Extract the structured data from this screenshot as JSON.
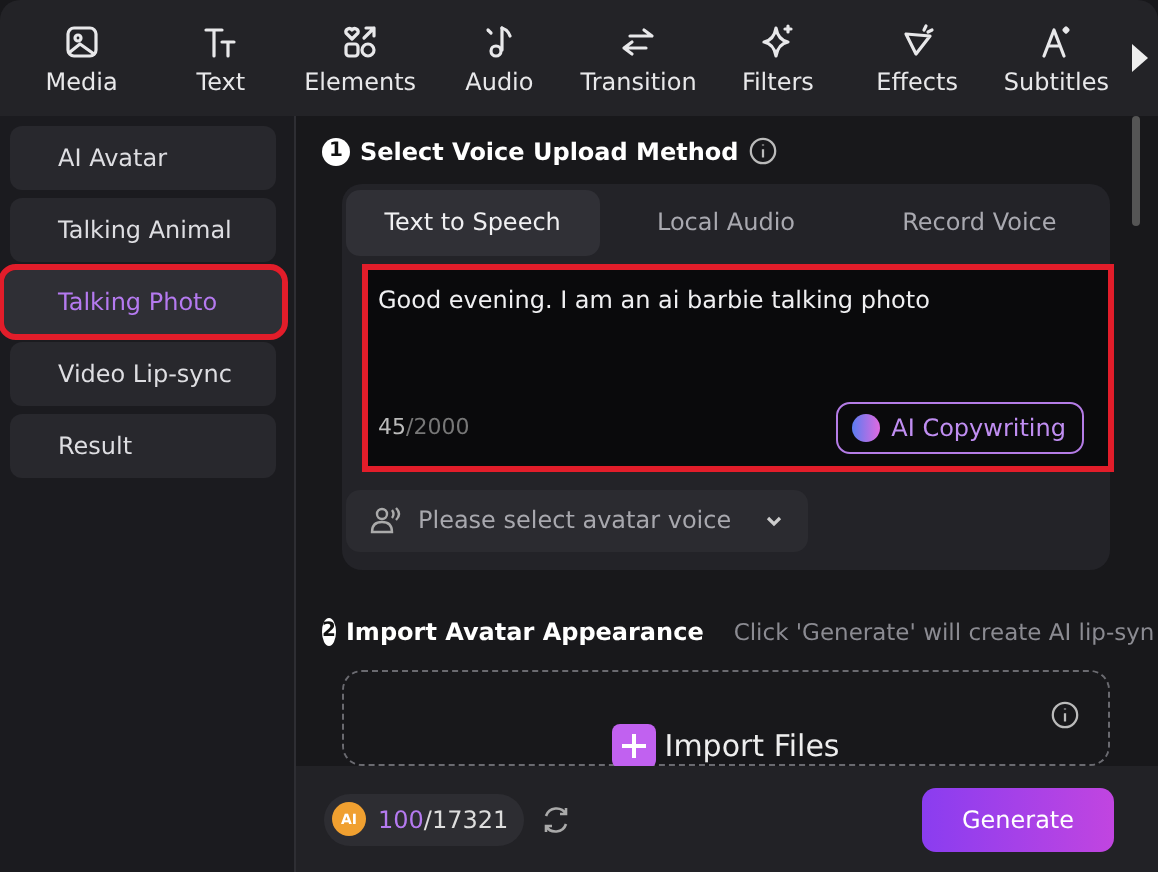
{
  "toolbar": {
    "items": [
      {
        "label": "Media"
      },
      {
        "label": "Text"
      },
      {
        "label": "Elements"
      },
      {
        "label": "Audio"
      },
      {
        "label": "Transition"
      },
      {
        "label": "Filters"
      },
      {
        "label": "Effects"
      },
      {
        "label": "Subtitles"
      }
    ]
  },
  "sidebar": {
    "items": [
      {
        "label": "AI Avatar",
        "selected": false,
        "highlighted": false
      },
      {
        "label": "Talking Animal",
        "selected": false,
        "highlighted": false
      },
      {
        "label": "Talking Photo",
        "selected": true,
        "highlighted": true
      },
      {
        "label": "Video Lip-sync",
        "selected": false,
        "highlighted": false
      },
      {
        "label": "Result",
        "selected": false,
        "highlighted": false
      }
    ]
  },
  "step1": {
    "number": "1",
    "title": "Select Voice Upload Method",
    "tabs": [
      {
        "label": "Text to Speech",
        "selected": true
      },
      {
        "label": "Local Audio",
        "selected": false
      },
      {
        "label": "Record Voice",
        "selected": false
      }
    ],
    "text": {
      "value": "Good evening. I am an ai barbie talking photo",
      "count": "45",
      "limit": "/2000",
      "highlighted": true
    },
    "copywriting_button": "AI Copywriting",
    "voice_select": {
      "placeholder": "Please select avatar voice"
    }
  },
  "step2": {
    "number": "2",
    "title": "Import Avatar Appearance",
    "hint": "Click 'Generate' will create AI lip-syn",
    "import_button": "Import Files"
  },
  "footer": {
    "credits_used": "100",
    "credits_total": "/17321",
    "credits_badge": "AI",
    "generate_button": "Generate"
  }
}
